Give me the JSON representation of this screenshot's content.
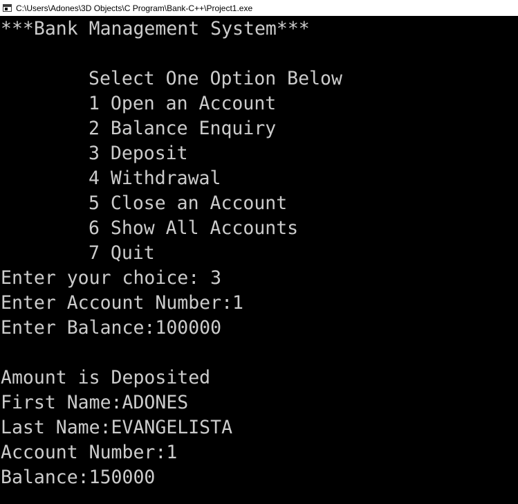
{
  "window": {
    "title": "C:\\Users\\Adones\\3D Objects\\C Program\\Bank-C++\\Project1.exe",
    "icon": "console-app-icon",
    "background_color": "#000000",
    "text_color": "#cccccc"
  },
  "console": {
    "header": "***Bank Management System***",
    "blank_1": "",
    "menu_prompt": "Select One Option Below",
    "menu_items": [
      "1 Open an Account",
      "2 Balance Enquiry",
      "3 Deposit",
      "4 Withdrawal",
      "5 Close an Account",
      "6 Show All Accounts",
      "7 Quit"
    ],
    "choice_line": "Enter your choice: 3",
    "account_number_line": "Enter Account Number:1",
    "balance_input_line": "Enter Balance:100000",
    "blank_2": "",
    "deposit_message": "Amount is Deposited",
    "first_name_line": "First Name:ADONES",
    "last_name_line": "Last Name:EVANGELISTA",
    "account_info_line": "Account Number:1",
    "balance_line": "Balance:150000"
  }
}
